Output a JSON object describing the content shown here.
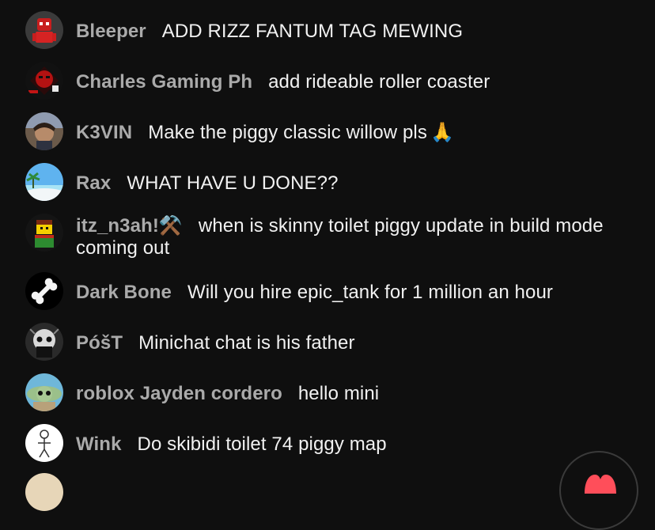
{
  "messages": [
    {
      "author": "Bleeper",
      "text": "ADD RIZZ FANTUM TAG MEWING",
      "avatar": "red-robot-avatar"
    },
    {
      "author": "Charles Gaming Ph",
      "text": "add rideable roller coaster",
      "avatar": "red-mask-avatar"
    },
    {
      "author": "K3VIN",
      "text": "Make the piggy classic willow pls",
      "emoji": "🙏",
      "avatar": "photo-avatar"
    },
    {
      "author": "Rax",
      "text": "WHAT HAVE U DONE??",
      "avatar": "beach-avatar"
    },
    {
      "author": "itz_n3ah!⚒️",
      "text": "when is skinny toilet piggy update in build mode coming out",
      "avatar": "yellow-character-avatar"
    },
    {
      "author": "Dark Bone",
      "text": "Will you hire epic_tank for 1 million an hour",
      "avatar": "bone-avatar"
    },
    {
      "author": "PóšT",
      "text": "Minichat chat is his father",
      "avatar": "skull-avatar"
    },
    {
      "author": "roblox Jayden cordero",
      "text": "hello mini",
      "avatar": "baby-yoda-avatar"
    },
    {
      "author": "Wink",
      "text": "Do skibidi toilet 74 piggy map",
      "avatar": "stick-figure-avatar"
    }
  ],
  "colors": {
    "background": "#0f0f0f",
    "author": "#aaaaaa",
    "text": "#f1f1f1",
    "heart": "#ff4e5a"
  },
  "icons": {
    "reaction_button": "heart-icon"
  }
}
